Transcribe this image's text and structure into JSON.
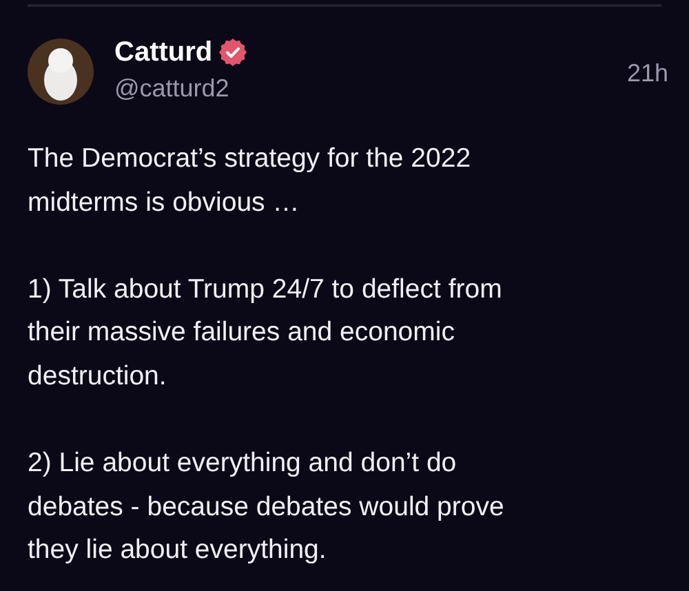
{
  "post": {
    "author": {
      "name": "Catturd",
      "verified": true,
      "handle": "@catturd2"
    },
    "time": "21h",
    "paragraphs": [
      {
        "lines": [
          "The Democrat’s strategy for the 2022",
          "midterms is obvious …"
        ]
      },
      {
        "lines": [
          "1) Talk about Trump 24/7 to deflect from",
          "their massive failures and economic",
          "destruction."
        ]
      },
      {
        "lines": [
          "2) Lie about everything and don’t do",
          "debates - because debates would prove",
          "they lie about everything."
        ]
      }
    ]
  }
}
